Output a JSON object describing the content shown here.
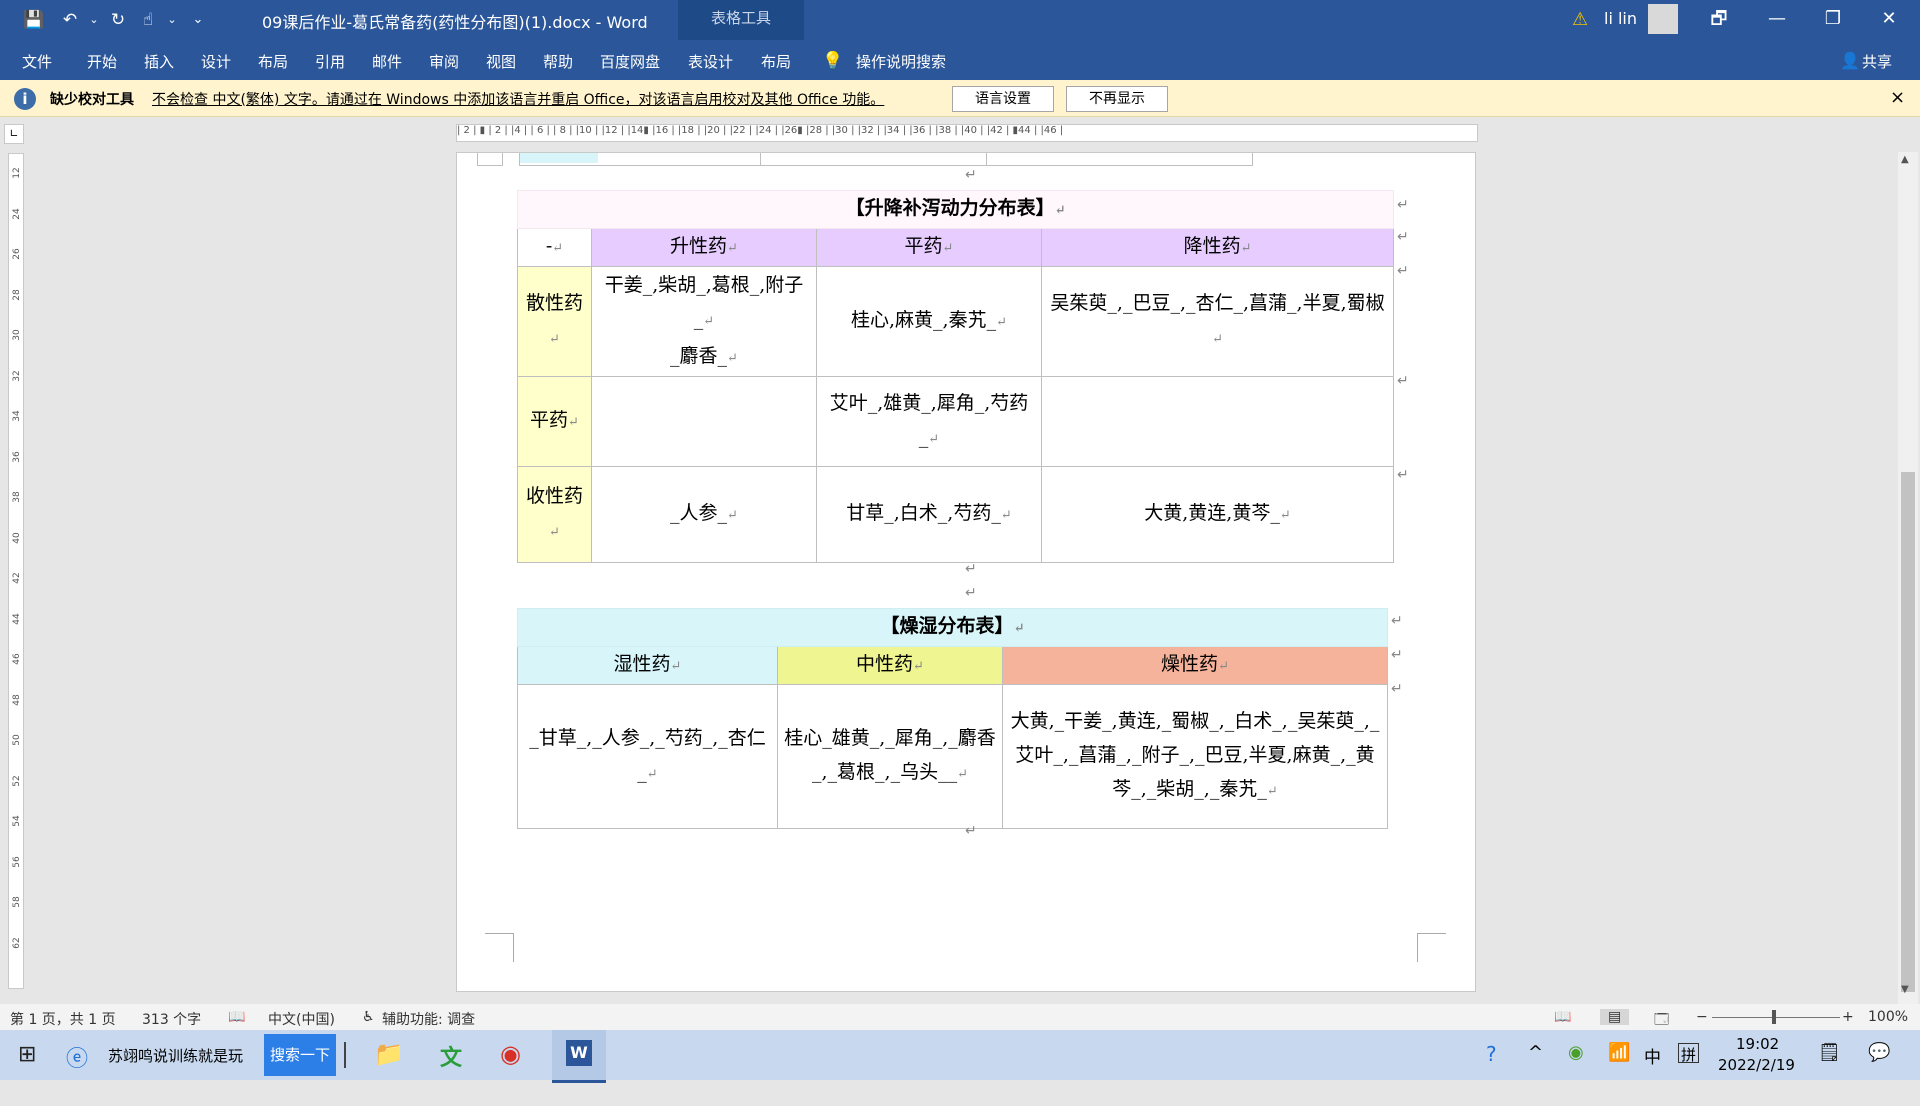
{
  "titlebar": {
    "doc_title": "09课后作业-葛氏常备药(药性分布图)(1).docx  -  Word",
    "context_tab": "表格工具",
    "user_name": "li lin",
    "qat_customize": "⌄",
    "win_restore": "🗗",
    "win_min": "—",
    "win_max": "❐",
    "win_close": "✕"
  },
  "ribbon": {
    "tabs": [
      "文件",
      "开始",
      "插入",
      "设计",
      "布局",
      "引用",
      "邮件",
      "审阅",
      "视图",
      "帮助",
      "百度网盘",
      "表设计",
      "布局"
    ],
    "tell_me": "操作说明搜索",
    "share": "共享"
  },
  "infobar": {
    "title": "缺少校对工具",
    "message": "不会检查 中文(繁体) 文字。请通过在 Windows 中添加该语言并重启 Office，对该语言启用校对及其他 Office 功能。",
    "button1": "语言设置",
    "button2": "不再显示",
    "close": "×"
  },
  "ruler_h": "| 2 |   ▮   | 2 |   |4 |     | 6 |    | 8 |    |10 |   |12 |   |14▮   |16 |   |18 |   |20 |   |22 |   |24 |   |26▮   |28 |   |30 |   |32 |   |34 |   |36 |   |38 |   |40 |   |42 |   ▮44 |   |46 |",
  "ruler_v": [
    "12",
    "24",
    "26",
    "28",
    "30",
    "32",
    "34",
    "36",
    "38",
    "40",
    "42",
    "44",
    "46",
    "48",
    "50",
    "52",
    "54",
    "56",
    "58",
    "62"
  ],
  "table1": {
    "title": "【升降补泻动力分布表】",
    "corner": "-",
    "col_headers": [
      "升性药",
      "平药",
      "降性药"
    ],
    "rows": [
      {
        "label": "散性药",
        "cells": [
          "干姜_,柴胡_,葛根_,附子_",
          "桂心,麻黄_,秦艽_",
          "吴茱萸_,_巴豆_,_杏仁_,菖蒲_,半夏,蜀椒"
        ],
        "extra": "_麝香_"
      },
      {
        "label": "平药",
        "cells": [
          "",
          "艾叶_,雄黄_,犀角_,芍药_",
          ""
        ]
      },
      {
        "label": "收性药",
        "cells": [
          "_人参_",
          "甘草_,白术_,芍药_",
          "大黄,黄连,黄芩_"
        ]
      }
    ]
  },
  "table2": {
    "title": "【燥湿分布表】",
    "col_headers": [
      "湿性药",
      "中性药",
      "燥性药"
    ],
    "cells": [
      "_甘草_,_人参_,_芍药_,_杏仁_",
      "桂心_雄黄_,_犀角_,_麝香_,_葛根_,_乌头__",
      "大黄,_干姜_,黄连,_蜀椒_,_白术_,_吴茱萸_,_艾叶_,_菖蒲_,_附子_,_巴豆,半夏,麻黄_,_黄芩_,_柴胡_,_秦艽_"
    ]
  },
  "para_mark": "↵",
  "statusbar": {
    "page": "第 1 页，共 1 页",
    "words": "313 个字",
    "lang": "中文(中国)",
    "accessibility": "辅助功能: 调查",
    "zoom": "100%",
    "zoom_minus": "−",
    "zoom_plus": "+"
  },
  "taskbar": {
    "browser_search": "苏翊鸣说训练就是玩",
    "search_btn": "搜索一下",
    "time": "19:02",
    "date": "2022/2/19",
    "ime_lang": "中",
    "ime_mode": "拼"
  },
  "colors": {
    "word_blue": "#2b579a",
    "purple": "#e6ccff",
    "yellow": "#ffffcc",
    "cyan": "#d8f6fa",
    "lime": "#eef591",
    "salmon": "#f6b39b"
  }
}
